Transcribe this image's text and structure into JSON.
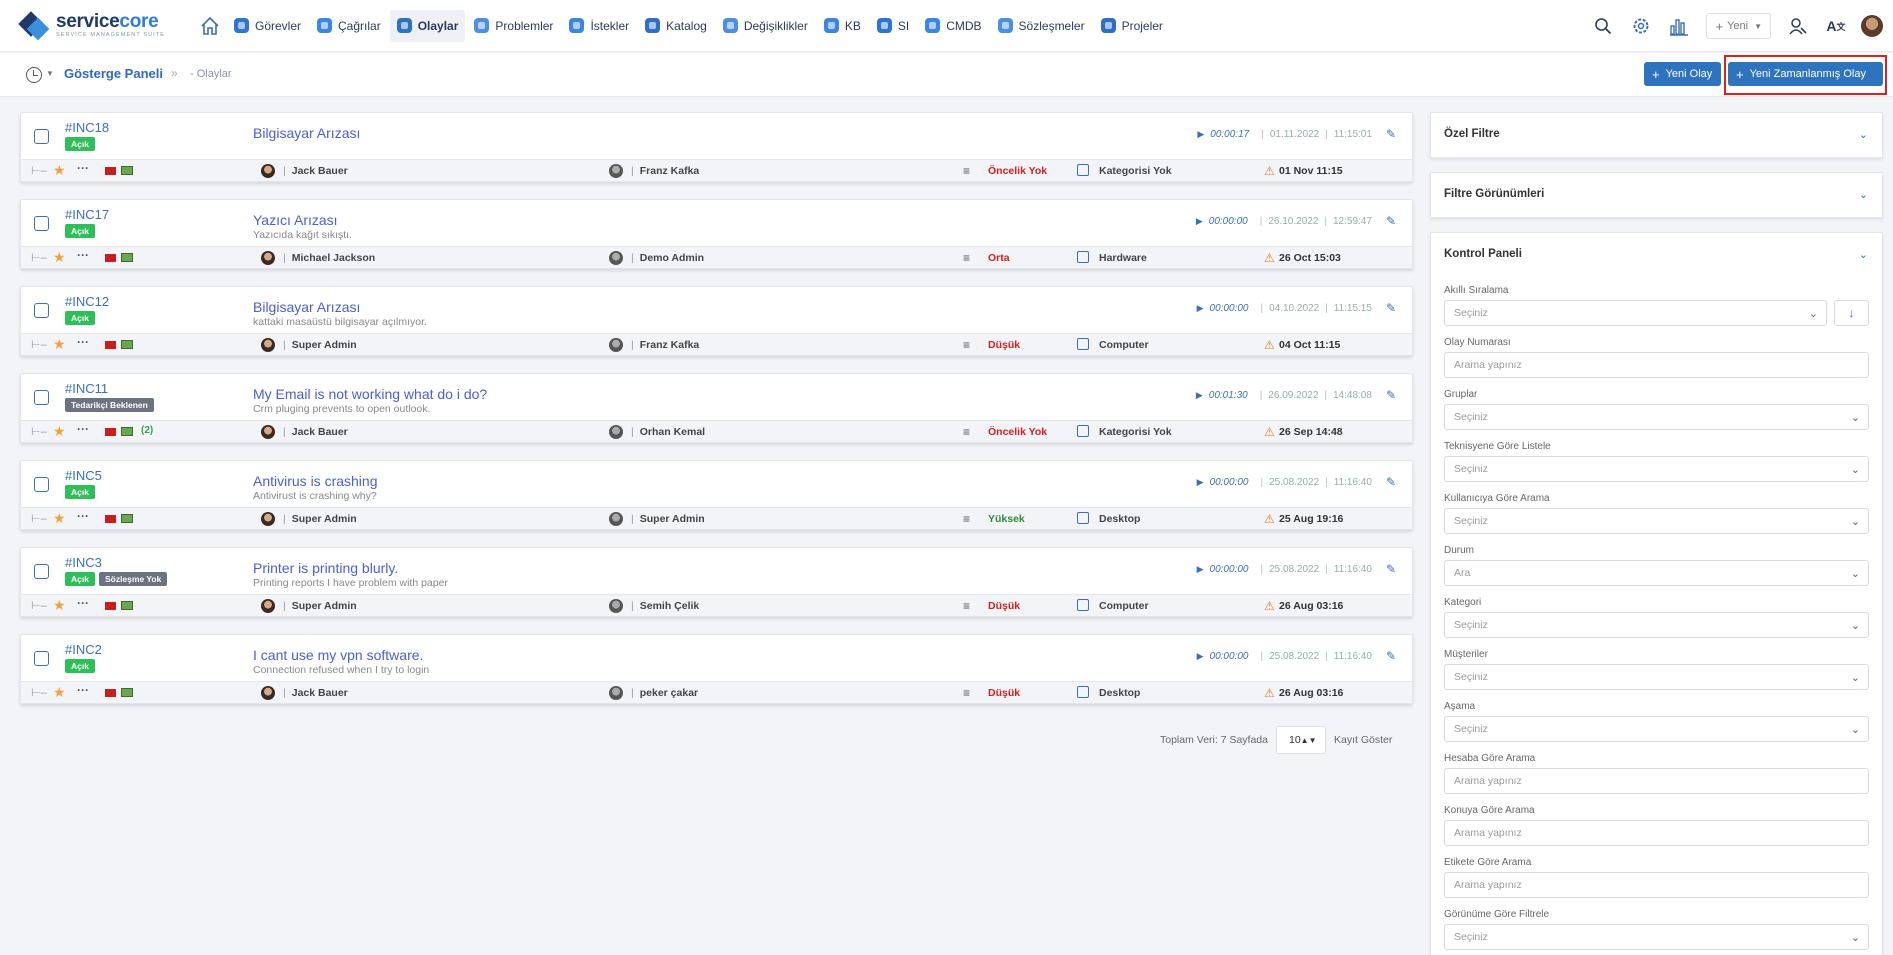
{
  "brand": {
    "name_a": "service",
    "name_b": "core",
    "tagline": "SERVICE MANAGEMENT SUITE"
  },
  "nav": {
    "items": [
      {
        "label": "Görevler",
        "color": "#2f74d0"
      },
      {
        "label": "Çağrılar",
        "color": "#3a86e0"
      },
      {
        "label": "Olaylar",
        "color": "#2d73bd",
        "active": true
      },
      {
        "label": "Problemler",
        "color": "#4d8fe0"
      },
      {
        "label": "İstekler",
        "color": "#3a86e0"
      },
      {
        "label": "Katalog",
        "color": "#2f6ec5"
      },
      {
        "label": "Değişiklikler",
        "color": "#4d8fe0"
      },
      {
        "label": "KB",
        "color": "#3a86e0"
      },
      {
        "label": "SI",
        "color": "#2f74d0"
      },
      {
        "label": "CMDB",
        "color": "#3a86e0"
      },
      {
        "label": "Sözleşmeler",
        "color": "#4d8fe0"
      },
      {
        "label": "Projeler",
        "color": "#2f6ec5"
      }
    ],
    "new_label": "Yeni"
  },
  "breadcrumb": {
    "main": "Gösterge Paneli",
    "current": "- Olaylar"
  },
  "actions": {
    "new_incident": "Yeni Olay",
    "new_scheduled": "Yeni Zamanlanmış Olay"
  },
  "incidents": [
    {
      "id": "#INC18",
      "badges": [
        {
          "label": "Açık",
          "kind": "green"
        }
      ],
      "title": "Bilgisayar Arızası",
      "desc": "",
      "time": "00:00:17",
      "date": "01.11.2022",
      "clock": "11:15:01",
      "count": "",
      "user1": "Jack Bauer",
      "user2": "Franz Kafka",
      "priority": "Öncelik Yok",
      "priority_color": "#d32020",
      "category": "Kategorisi Yok",
      "due": "01 Nov 11:15"
    },
    {
      "id": "#INC17",
      "badges": [
        {
          "label": "Açık",
          "kind": "green"
        }
      ],
      "title": "Yazıcı Arızası",
      "desc": "Yazıcıda kağıt sıkıştı.",
      "time": "00:00:00",
      "date": "26.10.2022",
      "clock": "12:59:47",
      "count": "",
      "user1": "Michael Jackson",
      "user2": "Demo Admin",
      "priority": "Orta",
      "priority_color": "#d32020",
      "category": "Hardware",
      "due": "26 Oct 15:03"
    },
    {
      "id": "#INC12",
      "badges": [
        {
          "label": "Açık",
          "kind": "green"
        }
      ],
      "title": "Bilgisayar Arızası",
      "desc": "kattaki masaüstü bilgisayar açılmıyor.",
      "time": "00:00:00",
      "date": "04.10.2022",
      "clock": "11:15:15",
      "count": "",
      "user1": "Super Admin",
      "user2": "Franz Kafka",
      "priority": "Düşük",
      "priority_color": "#d32020",
      "category": "Computer",
      "due": "04 Oct 11:15"
    },
    {
      "id": "#INC11",
      "badges": [
        {
          "label": "Tedarikçi Beklenen",
          "kind": "gray"
        }
      ],
      "title": "My Email is not working what do i do?",
      "desc": "Crm pluging prevents to open outlook.",
      "time": "00:01:30",
      "date": "26.09.2022",
      "clock": "14:48:08",
      "count": "(2)",
      "user1": "Jack Bauer",
      "user2": "Orhan Kemal",
      "priority": "Öncelik Yok",
      "priority_color": "#d32020",
      "category": "Kategorisi Yok",
      "due": "26 Sep 14:48"
    },
    {
      "id": "#INC5",
      "badges": [
        {
          "label": "Açık",
          "kind": "green"
        }
      ],
      "title": "Antivirus is crashing",
      "desc": "Antivirust is crashing why?",
      "time": "00:00:00",
      "date": "25.08.2022",
      "clock": "11:16:40",
      "count": "",
      "user1": "Super Admin",
      "user2": "Super Admin",
      "priority": "Yüksek",
      "priority_color": "#2f8a3a",
      "category": "Desktop",
      "due": "25 Aug 19:16"
    },
    {
      "id": "#INC3",
      "badges": [
        {
          "label": "Açık",
          "kind": "green"
        },
        {
          "label": "Sözleşme Yok",
          "kind": "gray"
        }
      ],
      "title": "Printer is printing blurly.",
      "desc": "Printing reports I have problem with paper",
      "time": "00:00:00",
      "date": "25.08.2022",
      "clock": "11:16:40",
      "count": "",
      "user1": "Super Admin",
      "user2": "Semih Çelik",
      "priority": "Düşük",
      "priority_color": "#d32020",
      "category": "Computer",
      "due": "26 Aug 03:16"
    },
    {
      "id": "#INC2",
      "badges": [
        {
          "label": "Açık",
          "kind": "green"
        }
      ],
      "title": "I cant use my vpn software.",
      "desc": "Connection refused when I try to login",
      "time": "00:00:00",
      "date": "25.08.2022",
      "clock": "11:16:40",
      "count": "",
      "user1": "Jack Bauer",
      "user2": "peker çakar",
      "priority": "Düşük",
      "priority_color": "#d32020",
      "category": "Desktop",
      "due": "26 Aug 03:16"
    }
  ],
  "pager": {
    "total": "Toplam Veri: 7 Sayfada",
    "page_size": "10",
    "suffix": "Kayıt Göster"
  },
  "side": {
    "special_filter": "Özel Filtre",
    "filter_views": "Filtre Görünümleri",
    "control_panel": "Kontrol Paneli",
    "fields": [
      {
        "label": "Akıllı Sıralama",
        "value": "Seçiniz",
        "type": "select",
        "extra": "sort"
      },
      {
        "label": "Olay Numarası",
        "value": "Arama yapınız",
        "type": "input"
      },
      {
        "label": "Gruplar",
        "value": "Seçiniz",
        "type": "select"
      },
      {
        "label": "Teknisyene Göre Listele",
        "value": "Seçiniz",
        "type": "select"
      },
      {
        "label": "Kullanıcıya Göre Arama",
        "value": "Seçiniz",
        "type": "select"
      },
      {
        "label": "Durum",
        "value": "Ara",
        "type": "select"
      },
      {
        "label": "Kategori",
        "value": "Seçiniz",
        "type": "select"
      },
      {
        "label": "Müşteriler",
        "value": "Seçiniz",
        "type": "select"
      },
      {
        "label": "Aşama",
        "value": "Seçiniz",
        "type": "select"
      },
      {
        "label": "Hesaba Göre Arama",
        "value": "Arama yapınız",
        "type": "input"
      },
      {
        "label": "Konuya Göre Arama",
        "value": "Arama yapınız",
        "type": "input"
      },
      {
        "label": "Etikete Göre Arama",
        "value": "Arama yapınız",
        "type": "input"
      },
      {
        "label": "Görünüme Göre Filtrele",
        "value": "Seçiniz",
        "type": "select"
      }
    ]
  }
}
